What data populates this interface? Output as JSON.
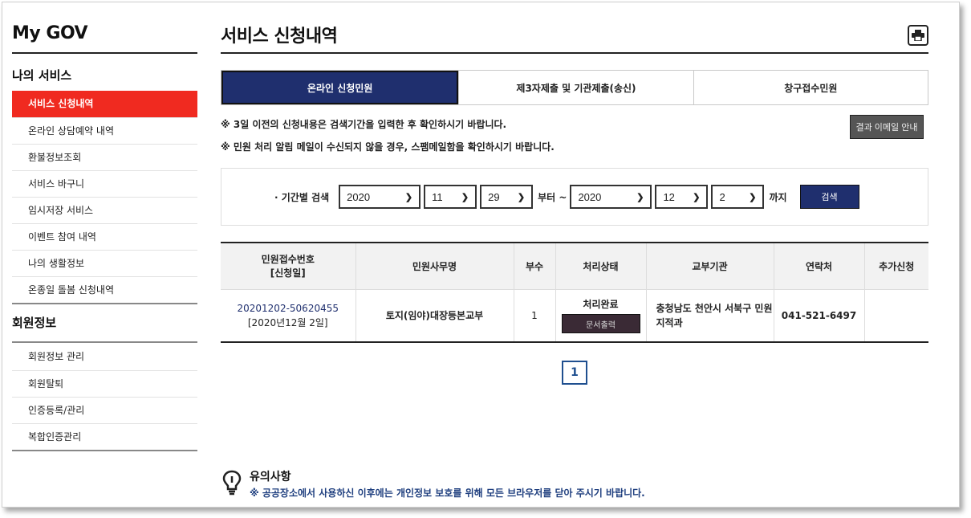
{
  "sidebar": {
    "brand": "My GOV",
    "my_services_title": "나의 서비스",
    "items": [
      {
        "label": "서비스 신청내역"
      },
      {
        "label": "온라인 상담예약 내역"
      },
      {
        "label": "환불정보조회"
      },
      {
        "label": "서비스 바구니"
      },
      {
        "label": "임시저장 서비스"
      },
      {
        "label": "이벤트 참여 내역"
      },
      {
        "label": "나의 생활정보"
      },
      {
        "label": "온종일 돌봄 신청내역"
      }
    ],
    "member_title": "회원정보",
    "member_items": [
      {
        "label": "회원정보 관리"
      },
      {
        "label": "회원탈퇴"
      },
      {
        "label": "인증등록/관리"
      },
      {
        "label": "복합인증관리"
      }
    ]
  },
  "main": {
    "title": "서비스 신청내역",
    "print_icon": "printer-icon",
    "tabs": [
      {
        "label": "온라인 신청민원"
      },
      {
        "label": "제3자제출 및 기관제출(송신)"
      },
      {
        "label": "창구접수민원"
      }
    ],
    "notices": [
      {
        "mark": "※",
        "text": "3일 이전의 신청내용은 검색기간을 입력한 후 확인하시기 바랍니다."
      },
      {
        "mark": "※",
        "text": "민원 처리 알림 메일이 수신되지 않을 경우, 스팸메일함을 확인하시기 바랍니다."
      }
    ],
    "email_button": "결과 이메일 안내",
    "search": {
      "label": "· 기간별 검색",
      "from_year": "2020",
      "from_month": "11",
      "from_day": "29",
      "from_text": "부터 ~",
      "to_year": "2020",
      "to_month": "12",
      "to_day": "2",
      "to_text": "까지",
      "button": "검색"
    },
    "table": {
      "headers": {
        "recv_no_line1": "민원접수번호",
        "recv_no_line2": "[신청일]",
        "name": "민원사무명",
        "count": "부수",
        "status": "처리상태",
        "agency": "교부기관",
        "contact": "연락처",
        "extra": "추가신청"
      },
      "rows": [
        {
          "recv_no": "20201202-50620455",
          "date": "[2020년12월 2일]",
          "name": "토지(임야)대장등본교부",
          "count": "1",
          "status": "처리완료",
          "status_button": "문서출력",
          "agency": "충청남도 천안시 서북구 민원지적과",
          "contact": "041-521-6497",
          "extra": ""
        }
      ]
    },
    "pagination": {
      "current": "1"
    }
  },
  "caution": {
    "icon": "lightbulb-icon",
    "title": "유의사항",
    "text": "※ 공공장소에서 사용하신 이후에는 개인정보 보호를 위해 모든 브라우저를 닫아 주시기 바랍니다."
  }
}
